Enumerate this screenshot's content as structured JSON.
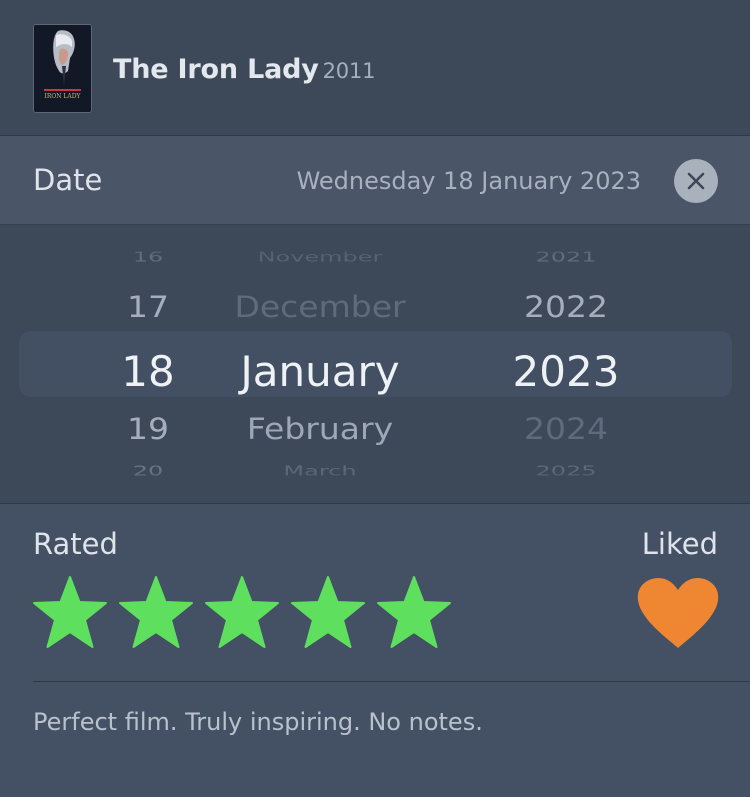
{
  "film": {
    "title": "The Iron Lady",
    "year": "2011",
    "poster_caption": "IRON LADY"
  },
  "date_row": {
    "label": "Date",
    "value": "Wednesday 18 January 2023",
    "clear_icon": "close-icon"
  },
  "picker": {
    "days": [
      "16",
      "17",
      "18",
      "19",
      "20"
    ],
    "months": [
      "November",
      "December",
      "January",
      "February",
      "March"
    ],
    "years": [
      "2021",
      "2022",
      "2023",
      "2024",
      "2025"
    ],
    "selected_index": 2
  },
  "rating": {
    "label": "Rated",
    "stars": 5,
    "max": 5,
    "color": "#5ee05e"
  },
  "like": {
    "label": "Liked",
    "liked": true,
    "color": "#ef8732"
  },
  "review": "Perfect film. Truly inspiring. No notes.",
  "colors": {
    "background": "#445164",
    "header": "#3d4859",
    "accent_star": "#5ee05e",
    "accent_heart": "#ef8732"
  }
}
